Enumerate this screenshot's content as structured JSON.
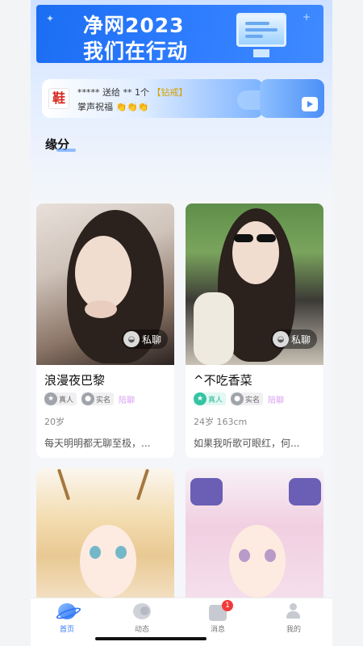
{
  "banner": {
    "line1": "净网2023",
    "line2": "我们在行动"
  },
  "gift_ticker": {
    "line1_prefix": "***** 送给 ** 1个",
    "line1_item": "【钻戒】",
    "line2": "掌声祝福 👏👏👏",
    "avatar_text": "鞋"
  },
  "section": {
    "title": "缘分"
  },
  "cards": [
    {
      "name": "浪漫夜巴黎",
      "badge_real": "真人",
      "badge_verified": "实名",
      "tag": "陪聊",
      "info": "20岁",
      "bio": "每天明明都无聊至极，...",
      "chat_label": "私聊"
    },
    {
      "name": "^不吃香菜",
      "badge_real": "真人",
      "badge_verified": "实名",
      "tag": "陪聊",
      "info": "24岁  163cm",
      "bio": "如果我听歌可眼红，何...",
      "chat_label": "私聊"
    }
  ],
  "tabbar": {
    "items": [
      {
        "label": "首页",
        "icon": "home-planet-icon"
      },
      {
        "label": "动态",
        "icon": "feed-icon"
      },
      {
        "label": "消息",
        "icon": "message-icon",
        "badge": "1"
      },
      {
        "label": "我的",
        "icon": "profile-icon"
      }
    ]
  },
  "colors": {
    "accent": "#3478f6",
    "real_badge": "#34c4a3",
    "tag": "#d9a2f2",
    "notify": "#f23a3a"
  }
}
